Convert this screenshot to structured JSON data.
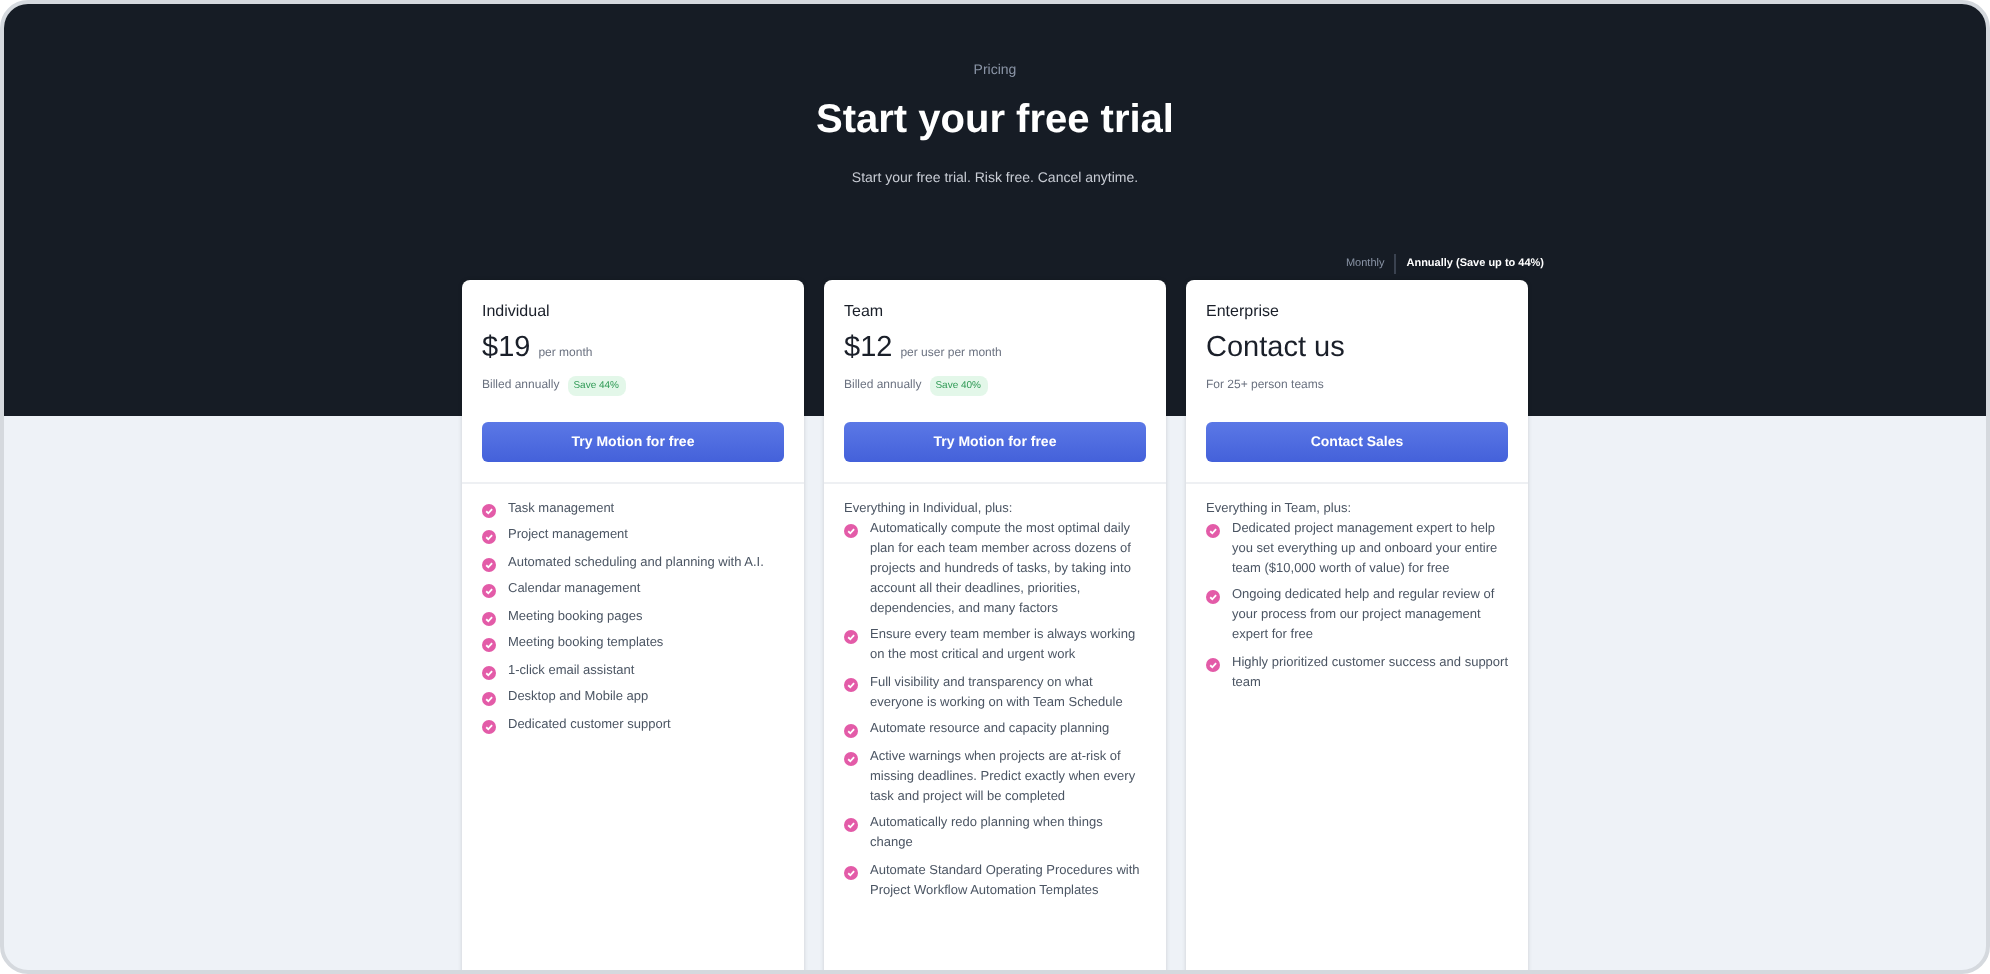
{
  "header": {
    "eyebrow": "Pricing",
    "title": "Start your free trial",
    "subtitle": "Start your free trial. Risk free. Cancel anytime."
  },
  "billing_toggle": [
    {
      "label": "Monthly",
      "selected": false
    },
    {
      "label": "Annually (Save up to 44%)",
      "selected": true
    }
  ],
  "plans": [
    {
      "name": "Individual",
      "price": "$19",
      "price_unit": "per month",
      "billing": "Billed annually",
      "badge": "Save 44%",
      "button": "Try Motion for free",
      "features": [
        "Task management",
        "Project management",
        "Automated scheduling and planning with A.I.",
        "Calendar management",
        "Meeting booking pages",
        "Meeting booking templates",
        "1-click email assistant",
        "Desktop and Mobile app",
        "Dedicated customer support"
      ]
    },
    {
      "name": "Team",
      "price": "$12",
      "price_unit": "per user per month",
      "billing": "Billed annually",
      "badge": "Save 40%",
      "button": "Try Motion for free",
      "intro": "Everything in Individual, plus:",
      "features": [
        "Automatically compute the most optimal daily plan for each team member across dozens of projects and hundreds of tasks, by taking into account all their deadlines, priorities, dependencies, and many factors",
        "Ensure every team member is always working on the most critical and urgent work",
        "Full visibility and transparency on what everyone is working on with Team Schedule",
        "Automate resource and capacity planning",
        "Active warnings when projects are at-risk of missing deadlines. Predict exactly when every task and project will be completed",
        "Automatically redo planning when things change",
        "Automate Standard Operating Procedures with Project Workflow Automation Templates"
      ]
    },
    {
      "name": "Enterprise",
      "price": "Contact us",
      "billing": "For 25+ person teams",
      "button": "Contact Sales",
      "intro": "Everything in Team, plus:",
      "features": [
        "Dedicated project management expert to help you set everything up and onboard your entire team ($10,000 worth of value) for free",
        "Ongoing dedicated help and regular review of your process from our project management expert for free",
        "Highly prioritized customer success and support team"
      ]
    }
  ]
}
